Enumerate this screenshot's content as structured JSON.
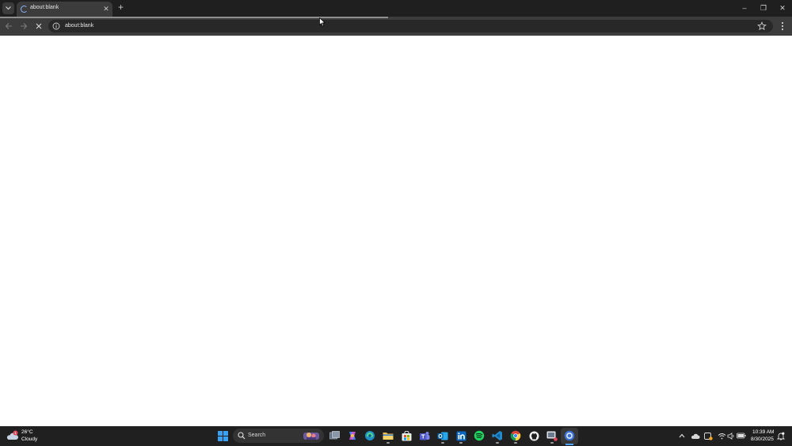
{
  "browser": {
    "tab": {
      "title": "about:blank",
      "loading": true
    },
    "address": {
      "text": "about:blank"
    },
    "load_progress": 0.49,
    "window_controls": {
      "minimize": "–",
      "restore": "❐",
      "close": "✕"
    },
    "new_tab_symbol": "+",
    "tab_close_symbol": "✕"
  },
  "taskbar": {
    "weather": {
      "temperature": "26°C",
      "condition": "Cloudy",
      "badge": "1"
    },
    "search": {
      "placeholder": "Search"
    },
    "apps": [
      "windows-start",
      "task-view",
      "copilot",
      "edge",
      "file-explorer",
      "microsoft-store",
      "teams",
      "outlook",
      "linkedin",
      "spotify",
      "vscode",
      "chrome",
      "github-desktop",
      "snipping-tool",
      "chrome-active"
    ],
    "tray": [
      "chevron-up",
      "cloud",
      "update-badge",
      "wifi",
      "speaker",
      "battery"
    ],
    "clock": {
      "time": "10:39 AM",
      "date": "8/30/2025"
    }
  },
  "colors": {
    "tabstrip": "#1f1f1f",
    "toolbar": "#3c3c3c",
    "taskbar": "#202020",
    "accent": "#4fa3ff"
  }
}
